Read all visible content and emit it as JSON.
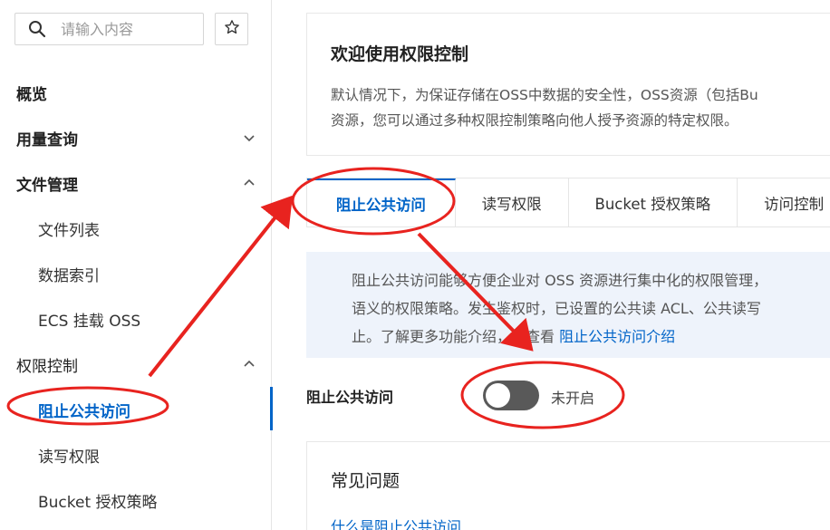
{
  "sidebar": {
    "search_placeholder": "请输入内容",
    "items": [
      {
        "label": "概览"
      },
      {
        "label": "用量查询"
      },
      {
        "label": "文件管理"
      },
      {
        "label": "文件列表"
      },
      {
        "label": "数据索引"
      },
      {
        "label": "ECS 挂载 OSS"
      },
      {
        "label": "权限控制"
      },
      {
        "label": "阻止公共访问"
      },
      {
        "label": "读写权限"
      },
      {
        "label": "Bucket 授权策略"
      }
    ]
  },
  "welcome": {
    "title": "欢迎使用权限控制",
    "desc_line1": "默认情况下，为保证存储在OSS中数据的安全性，OSS资源（包括Bu",
    "desc_line2": "资源，您可以通过多种权限控制策略向他人授予资源的特定权限。"
  },
  "tabs": [
    {
      "label": "阻止公共访问"
    },
    {
      "label": "读写权限"
    },
    {
      "label": "Bucket 授权策略"
    },
    {
      "label": "访问控制"
    }
  ],
  "info": {
    "line1": "阻止公共访问能够方便企业对 OSS 资源进行集中化的权限管理，",
    "line2": "语义的权限策略。发生鉴权时，已设置的公共读 ACL、公共读写",
    "line3_prefix": "止。了解更多功能介绍，请查看 ",
    "line3_link": "阻止公共访问介绍"
  },
  "block_public_access": {
    "label": "阻止公共访问",
    "status": "未开启",
    "enabled": false
  },
  "faq": {
    "title": "常见问题",
    "link": "什么是阻止公共访问"
  },
  "colors": {
    "accent": "#0064c8",
    "annotation": "#e8231f",
    "switch_off": "#595959",
    "info_bg": "#eef3fb"
  }
}
